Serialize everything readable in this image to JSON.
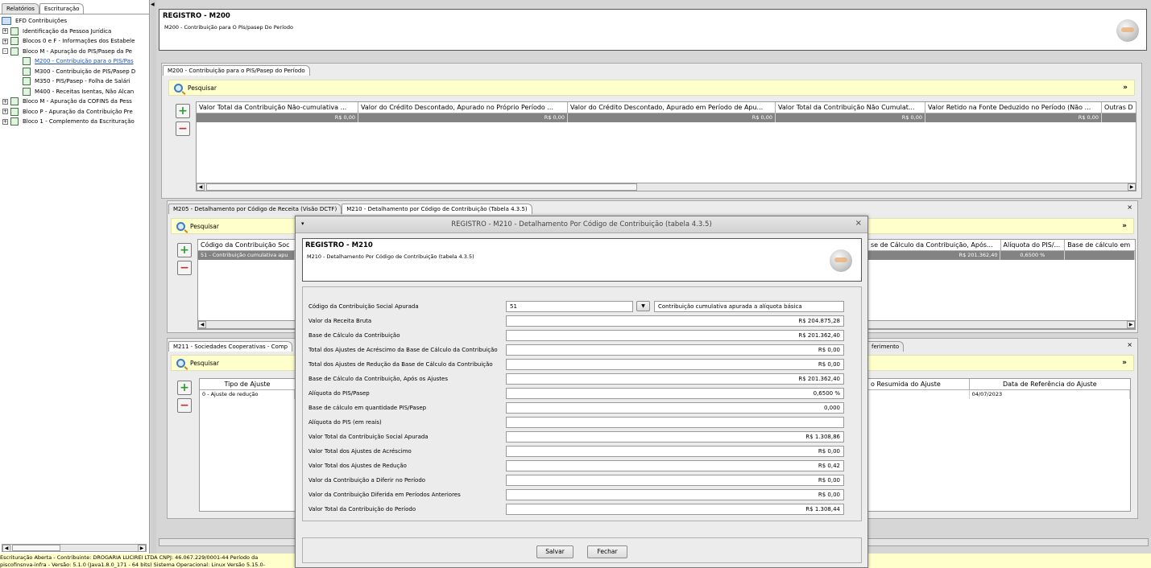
{
  "left_tabs": [
    "Relatórios",
    "Escrituração"
  ],
  "tree": {
    "root": "EFD Contribuições",
    "items": [
      {
        "label": "Identificação da Pessoa Jurídica",
        "level": 1,
        "exp": "+"
      },
      {
        "label": "Blocos 0 e F - Informações dos Estabele",
        "level": 1,
        "exp": "+"
      },
      {
        "label": "Bloco M - Apuração do PIS/Pasep da Pe",
        "level": 1,
        "exp": "-"
      },
      {
        "label": "M200 - Contribuição para o PIS/Pas",
        "level": 2,
        "exp": "",
        "selected": true
      },
      {
        "label": "M300 - Contribuição de PIS/Pasep D",
        "level": 2,
        "exp": ""
      },
      {
        "label": "M350 - PIS/Pasep - Folha de Salári",
        "level": 2,
        "exp": ""
      },
      {
        "label": "M400 - Receitas Isentas, Não Alcan",
        "level": 2,
        "exp": ""
      },
      {
        "label": "Bloco M - Apuração da COFINS da Pess",
        "level": 1,
        "exp": "+"
      },
      {
        "label": "Bloco P - Apuração da Contribuição Pre",
        "level": 1,
        "exp": "+"
      },
      {
        "label": "Bloco 1 - Complemento da Escrituração",
        "level": 1,
        "exp": "+"
      }
    ]
  },
  "header": {
    "title": "REGISTRO - M200",
    "subtitle": "M200 - Contribuição para O Pis/pasep Do Período"
  },
  "m200": {
    "tab": "M200 - Contribuição para o PIS/Pasep do Período",
    "search": "Pesquisar",
    "columns": [
      "Valor Total da Contribuição Não-cumulativa ...",
      "Valor do Crédito Descontado, Apurado no Próprio Período ...",
      "Valor do Crédito Descontado, Apurado em Período de Apu...",
      "Valor Total da Contribuição Não Cumulat...",
      "Valor Retido na Fonte Deduzido no Período (Não ...",
      "Outras D"
    ],
    "row": [
      "R$ 0,00",
      "R$ 0,00",
      "R$ 0,00",
      "R$ 0,00",
      "R$ 0,00",
      ""
    ]
  },
  "m205": {
    "tabs": [
      "M205 - Detalhamento por Código de Receita (Visão DCTF)",
      "M210 - Detalhamento por Código de Contribuição (Tabela 4.3.5)"
    ],
    "search": "Pesquisar",
    "col_left": "Código da Contribuição Soc",
    "row_left": "51 - Contribuição cumulativa apu",
    "col_right": [
      "se de Cálculo da Contribuição, Após...",
      "Alíquota do PIS/...",
      "Base de cálculo em"
    ],
    "row_right": [
      "R$ 201.362,40",
      "0,6500 %",
      ""
    ]
  },
  "m211": {
    "tab_left": "M211 - Sociedades Cooperativas - Comp",
    "tab_right": "ferimento",
    "search": "Pesquisar",
    "col_left": "Tipo de Ajuste",
    "row_left": "0 - Ajuste de redução",
    "col_right": [
      "o Resumida do Ajuste",
      "Data de Referência do Ajuste"
    ],
    "row_right": [
      "",
      "04/07/2023"
    ]
  },
  "dialog": {
    "title": "REGISTRO - M210 - Detalhamento Por Código de Contribuição (tabela 4.3.5)",
    "header_title": "REGISTRO - M210",
    "header_subtitle": "M210 - Detalhamento Por Código de Contribuição (tabela 4.3.5)",
    "codigo_label": "Código da Contribuição Social Apurada",
    "codigo_value": "51",
    "codigo_desc": "Contribuição cumulativa apurada a alíquota básica",
    "fields": [
      {
        "label": "Valor da Receita Bruta",
        "value": "R$ 204.875,28"
      },
      {
        "label": "Base de Cálculo da Contribuição",
        "value": "R$ 201.362,40"
      },
      {
        "label": "Total dos Ajustes de Acréscimo da Base de Cálculo da Contribuição",
        "value": "R$ 0,00"
      },
      {
        "label": "Total dos Ajustes de Redução da Base de Cálculo da Contribuição",
        "value": "R$ 0,00"
      },
      {
        "label": "Base de Cálculo da Contribuição, Após os Ajustes",
        "value": "R$ 201.362,40"
      },
      {
        "label": "Alíquota do PIS/Pasep",
        "value": "0,6500 %"
      },
      {
        "label": "Base de cálculo em quantidade PIS/Pasep",
        "value": "0,000"
      },
      {
        "label": "Alíquota do PIS (em reais)",
        "value": ""
      },
      {
        "label": "Valor Total da Contribuição Social Apurada",
        "value": "R$ 1.308,86"
      },
      {
        "label": "Valor Total dos Ajustes de Acréscimo",
        "value": "R$ 0,00"
      },
      {
        "label": "Valor Total dos Ajustes de Redução",
        "value": "R$ 0,42"
      },
      {
        "label": "Valor da Contribuição a Diferir no Período",
        "value": "R$ 0,00"
      },
      {
        "label": "Valor da Contribuição Diferida em Períodos Anteriores",
        "value": "R$ 0,00"
      },
      {
        "label": "Valor Total da Contribuição do Período",
        "value": "R$ 1.308,44"
      }
    ],
    "save": "Salvar",
    "close": "Fechar"
  },
  "status": {
    "line1": "Escrituração Aberta - Contribuinte: DROGARIA LUCIREI LTDA CNPJ: 46.067.229/0001-44 Período da",
    "line2": "piscofinsnva-infra - Versão: 5.1.0 (Java1.8.0_171 - 64 bits) Sistema Operacional: Linux Versão 5.15.0-"
  }
}
